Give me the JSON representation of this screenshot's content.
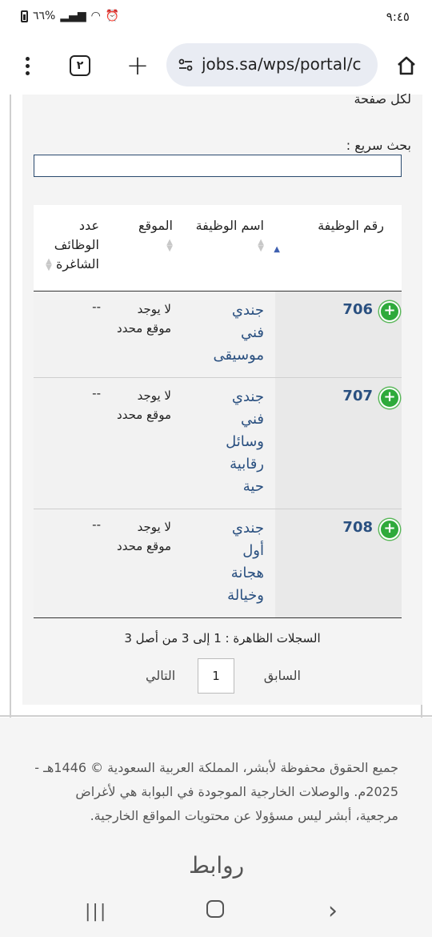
{
  "status_bar": {
    "time": "٩:٤٥",
    "battery": "٦٦%"
  },
  "browser": {
    "url": "jobs.sa/wps/portal/c",
    "tab_count": "٢",
    "icons": [
      "menu-dots-icon",
      "tab-switcher-icon",
      "new-tab-plus-icon",
      "site-settings-icon",
      "home-icon"
    ]
  },
  "page": {
    "clipped_text": "لكل صفحة",
    "quick_search_label": "بحث سريع :",
    "quick_search_value": "",
    "table": {
      "headers": {
        "job_number": "رقم الوظيفة",
        "job_name": "اسم الوظيفة",
        "location": "الموقع",
        "vacancies": "عدد الوظائف الشاغرة"
      },
      "rows": [
        {
          "number": "706",
          "name": "جندي فني موسيقى",
          "location": "لا يوجد موقع محدد",
          "vacancies": "--"
        },
        {
          "number": "707",
          "name": "جندي فني وسائل رقابية حية",
          "location": "لا يوجد موقع محدد",
          "vacancies": "--"
        },
        {
          "number": "708",
          "name": "جندي أول هجانة وخيالة",
          "location": "لا يوجد موقع محدد",
          "vacancies": "--"
        }
      ]
    },
    "records_info": "السجلات الظاهرة : 1 إلى 3 من أصل 3",
    "pager": {
      "prev": "السابق",
      "current_page": "1",
      "next": "التالي"
    }
  },
  "footer": {
    "copyright": "جميع الحقوق محفوظة لأبشر، المملكة العربية السعودية © 1446هـ - 2025م. والوصلات الخارجية الموجودة في البوابة هي لأغراض مرجعية، أبشر ليس مسؤولا عن محتويات المواقع الخارجية.",
    "links_heading": "روابط"
  },
  "colors": {
    "link_blue": "#2a5080",
    "add_green": "#2eaa3b",
    "panel_bg": "#f4f4f4"
  }
}
